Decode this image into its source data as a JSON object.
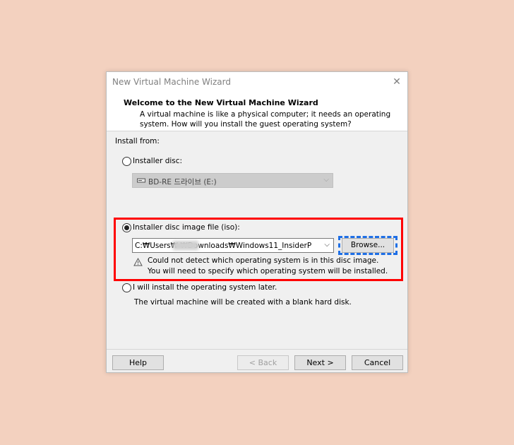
{
  "dialog": {
    "title": "New Virtual Machine Wizard",
    "close_glyph": "✕"
  },
  "header": {
    "title": "Welcome to the New Virtual Machine Wizard",
    "description": "A virtual machine is like a physical computer; it needs an operating system. How will you install the guest operating system?"
  },
  "install": {
    "label": "Install from:",
    "disc": {
      "label": "Installer disc:",
      "selected": false,
      "drive_value": "BD-RE 드라이브 (E:)",
      "icon": "disc-drive-icon"
    },
    "iso": {
      "label": "Installer disc image file (iso):",
      "selected": true,
      "path_value": "C:₩Users₩          ₩Downloads₩Windows11_InsiderP",
      "browse_label": "Browse...",
      "warning_line1": "Could not detect which operating system is in this disc image.",
      "warning_line2": "You will need to specify which operating system will be installed.",
      "warning_icon": "warning-icon"
    },
    "later": {
      "label": "I will install the operating system later.",
      "selected": false,
      "description": "The virtual machine will be created with a blank hard disk."
    }
  },
  "buttons": {
    "help": "Help",
    "back": "< Back",
    "next": "Next >",
    "cancel": "Cancel"
  },
  "colors": {
    "background": "#f3d1bf",
    "highlight": "#ff0000",
    "focus": "#1e6fe6"
  }
}
